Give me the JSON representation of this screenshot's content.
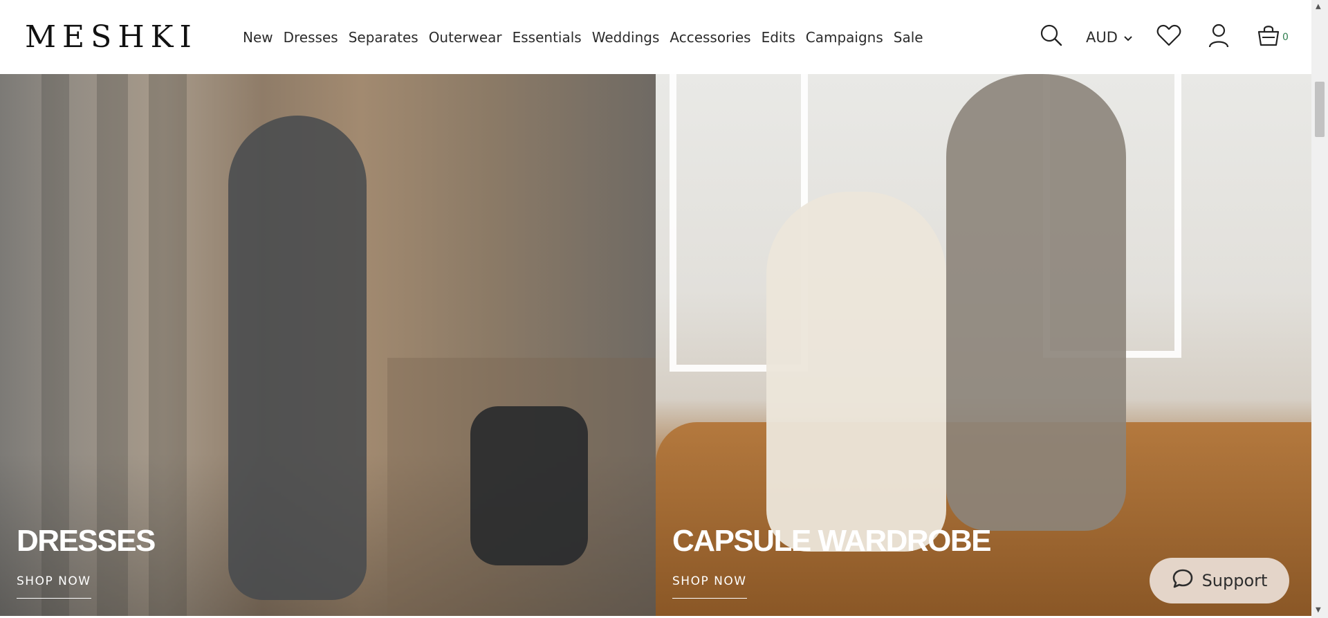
{
  "brand": {
    "logo_text": "MESHKI"
  },
  "nav": {
    "items": [
      {
        "label": "New"
      },
      {
        "label": "Dresses"
      },
      {
        "label": "Separates"
      },
      {
        "label": "Outerwear"
      },
      {
        "label": "Essentials"
      },
      {
        "label": "Weddings"
      },
      {
        "label": "Accessories"
      },
      {
        "label": "Edits"
      },
      {
        "label": "Campaigns"
      },
      {
        "label": "Sale"
      }
    ]
  },
  "utilities": {
    "currency": "AUD",
    "cart_count": "0",
    "icons": [
      "search-icon",
      "chevron-down-icon",
      "heart-icon",
      "user-icon",
      "cart-icon"
    ]
  },
  "hero": {
    "panels": [
      {
        "title": "DRESSES",
        "cta": "SHOP NOW"
      },
      {
        "title": "CAPSULE WARDROBE",
        "cta": "SHOP NOW"
      }
    ]
  },
  "support": {
    "label": "Support",
    "icon": "chat-bubble-icon"
  },
  "colors": {
    "support_bg": "#e4d5c9",
    "cart_count_color": "#2f7d4f",
    "text_dark": "#2b2b2b"
  }
}
